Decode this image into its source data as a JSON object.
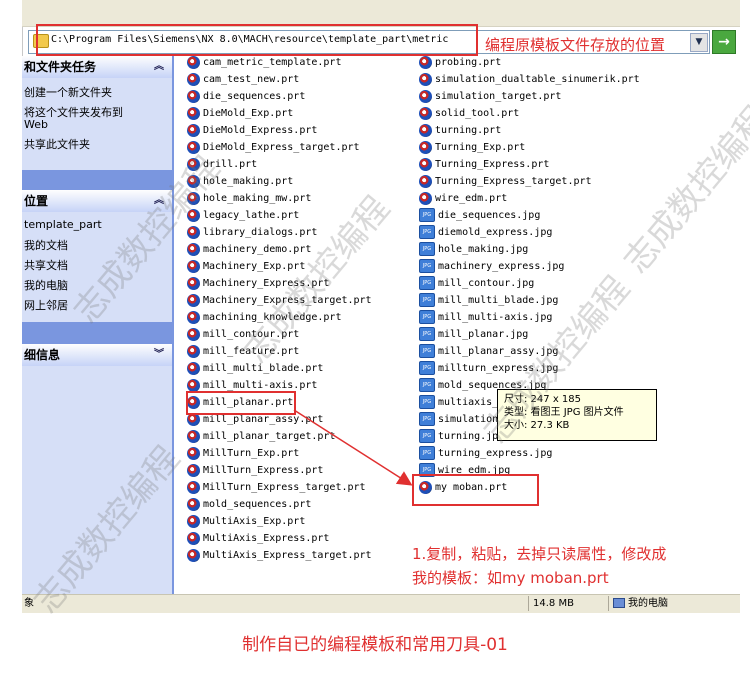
{
  "address_bar": {
    "path": "C:\\Program Files\\Siemens\\NX 8.0\\MACH\\resource\\template_part\\metric",
    "go_label": "→"
  },
  "task_pane": {
    "tasks_header": "和文件夹任务",
    "tasks": [
      "创建一个新文件夹",
      "将这个文件夹发布到",
      "Web",
      "共享此文件夹"
    ],
    "places_header": "位置",
    "places": [
      "template_part",
      "我的文档",
      "共享文档",
      "我的电脑",
      "网上邻居"
    ],
    "details_header": "细信息",
    "collapse_glyph": "⌃",
    "expand_glyph": "⌄"
  },
  "files_col1": [
    "cam_metric_template.prt",
    "cam_test_new.prt",
    "die_sequences.prt",
    "DieMold_Exp.prt",
    "DieMold_Express.prt",
    "DieMold_Express_target.prt",
    "drill.prt",
    "hole_making.prt",
    "hole_making_mw.prt",
    "legacy_lathe.prt",
    "library_dialogs.prt",
    "machinery_demo.prt",
    "Machinery_Exp.prt",
    "Machinery_Express.prt",
    "Machinery_Express_target.prt",
    "machining_knowledge.prt",
    "mill_contour.prt",
    "mill_feature.prt",
    "mill_multi_blade.prt",
    "mill_multi-axis.prt",
    "mill_planar.prt",
    "mill_planar_assy.prt",
    "mill_planar_target.prt",
    "MillTurn_Exp.prt",
    "MillTurn_Express.prt",
    "MillTurn_Express_target.prt",
    "mold_sequences.prt",
    "MultiAxis_Exp.prt",
    "MultiAxis_Express.prt",
    "MultiAxis_Express_target.prt"
  ],
  "files_col2": [
    {
      "name": "probing.prt",
      "type": "prt"
    },
    {
      "name": "simulation_dualtable_sinumerik.prt",
      "type": "prt"
    },
    {
      "name": "simulation_target.prt",
      "type": "prt"
    },
    {
      "name": "solid_tool.prt",
      "type": "prt"
    },
    {
      "name": "turning.prt",
      "type": "prt"
    },
    {
      "name": "Turning_Exp.prt",
      "type": "prt"
    },
    {
      "name": "Turning_Express.prt",
      "type": "prt"
    },
    {
      "name": "Turning_Express_target.prt",
      "type": "prt"
    },
    {
      "name": "wire_edm.prt",
      "type": "prt"
    },
    {
      "name": "die_sequences.jpg",
      "type": "jpg"
    },
    {
      "name": "diemold_express.jpg",
      "type": "jpg"
    },
    {
      "name": "hole_making.jpg",
      "type": "jpg"
    },
    {
      "name": "machinery_express.jpg",
      "type": "jpg"
    },
    {
      "name": "mill_contour.jpg",
      "type": "jpg"
    },
    {
      "name": "mill_multi_blade.jpg",
      "type": "jpg"
    },
    {
      "name": "mill_multi-axis.jpg",
      "type": "jpg"
    },
    {
      "name": "mill_planar.jpg",
      "type": "jpg"
    },
    {
      "name": "mill_planar_assy.jpg",
      "type": "jpg"
    },
    {
      "name": "millturn_express.jpg",
      "type": "jpg"
    },
    {
      "name": "mold_sequences.jpg",
      "type": "jpg"
    },
    {
      "name": "multiaxis_",
      "type": "jpg"
    },
    {
      "name": "simulation",
      "type": "jpg"
    },
    {
      "name": "turning.jp",
      "type": "jpg"
    },
    {
      "name": "turning_express.jpg",
      "type": "jpg"
    },
    {
      "name": "wire_edm.jpg",
      "type": "jpg"
    },
    {
      "name": "my moban.prt",
      "type": "prt"
    }
  ],
  "tooltip": {
    "size": "尺寸: 247 x 185",
    "type": "类型: 看图王 JPG 图片文件",
    "filesize": "大小: 27.3 KB"
  },
  "annotations": {
    "address_note": "编程原模板文件存放的位置",
    "step_line1": "1.复制，粘贴，去掉只读属性，修改成",
    "step_line2": "我的模板：如my moban.prt",
    "color": "#e03030"
  },
  "status_bar": {
    "left": "象",
    "size": "14.8 MB",
    "zone": "我的电脑"
  },
  "caption": "制作自已的编程模板和常用刀具-01",
  "watermark": "志成数控编程"
}
